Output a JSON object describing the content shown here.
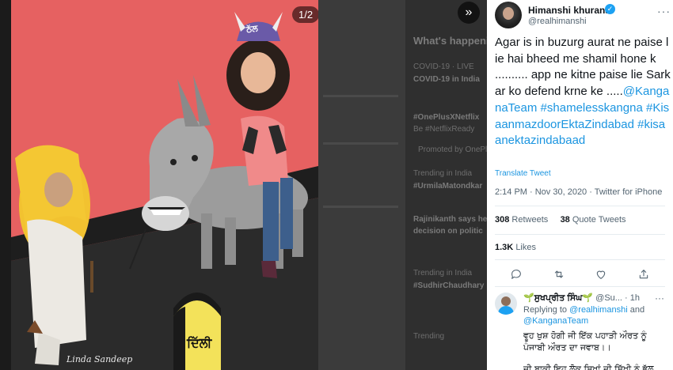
{
  "background": {
    "whats_happening": "What's happening",
    "items": [
      "COVID-19 · LIVE",
      "COVID-19 in India",
      "#OnePlusXNetflix",
      "Be #NetflixReady",
      "Promoted by OnePlus",
      "Trending in India",
      "#UrmilaMatondkar",
      "Rajinikanth says he",
      "decision on politic",
      "Trending in India",
      "#SudhirChaudhary",
      "Trending"
    ]
  },
  "media": {
    "counter": "1/2",
    "crown_text": "ਠੱਲ",
    "milestone_text": "ਦਿੱਲੀ",
    "signature": "Linda Sandeep"
  },
  "tweet": {
    "author_name": "Himanshi khurana",
    "author_handle": "@realhimanshi",
    "text_plain": "Agar is in buzurg aurat ne paise lie hai bheed me shamil hone k .......... app ne kitne paise lie Sarkar ko defend krne ke .....",
    "mention": "@KanganaTeam",
    "hashtag1": "#shamelesskangna",
    "hashtag2": "#KisaanmazdoorEktaZindabad",
    "hashtag3": "#kisaanektazindabaad",
    "translate": "Translate Tweet",
    "meta": "2:14 PM · Nov 30, 2020 · Twitter for iPhone",
    "retweets_count": "308",
    "retweets_label": "Retweets",
    "quotes_count": "38",
    "quotes_label": "Quote Tweets",
    "likes_count": "1.3K",
    "likes_label": "Likes"
  },
  "reply": {
    "sprout_left": "🌱",
    "name": "ਸੁਖਪ੍ਰੀਤ ਸਿੰਘ",
    "sprout_right": "🌱",
    "handle": "@Su...",
    "time": "· 1h",
    "replying_to": "Replying to",
    "reply_mention1": "@realhimanshi",
    "reply_and": "and",
    "reply_mention2": "@KanganaTeam",
    "body_line1": "ਵੂਹ ਖੁਸ਼ ਹੋਗੀ ਜੀ ਇੱਕ ਪਹਾੜੀ ਔਰਤ ਨੂੰ",
    "body_line2": "ਪੰਜਾਬੀ ਔਰਤ ਦਾ ਜਵਾਬ।।",
    "body_line3": "ਜੀ ਬਾਕੀ ਇਹ ਲੋਕ ਸਿਖਾਂ ਦੀ ਸਿੱਖੀ ਨੂੰ ਭੁੱਲ"
  },
  "colors": {
    "link": "#1b95e0",
    "verified": "#1da1f2",
    "artwork_bg": "#e05b5b"
  }
}
